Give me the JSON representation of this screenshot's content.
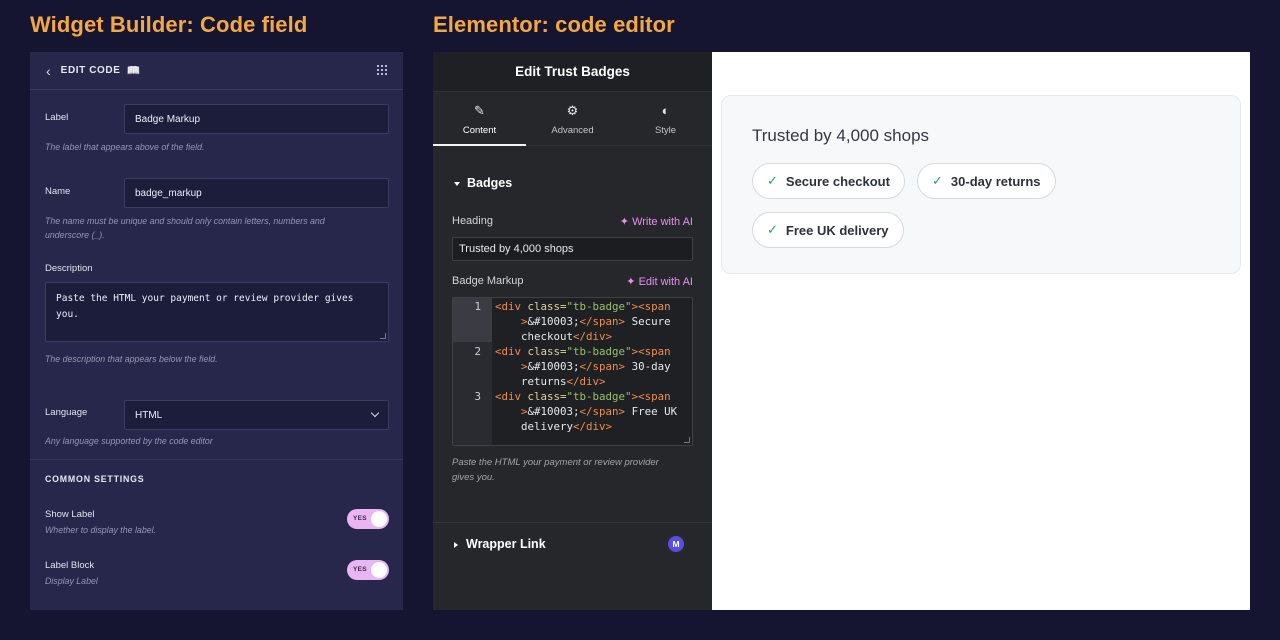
{
  "headings": {
    "left": "Widget Builder: Code field",
    "right": "Elementor: code editor"
  },
  "widget_builder": {
    "header": {
      "title": "EDIT CODE"
    },
    "label": {
      "label": "Label",
      "value": "Badge Markup",
      "help": "The label that appears above of the field."
    },
    "name": {
      "label": "Name",
      "value": "badge_markup",
      "help_line1": "The name must be unique and should only contain letters, numbers and",
      "help_line2": "underscore (_)."
    },
    "description": {
      "label": "Description",
      "value_line1": "Paste the HTML your payment or review provider gives",
      "value_line2": "you.",
      "help": "The description that appears below the field."
    },
    "language": {
      "label": "Language",
      "value": "HTML",
      "help": "Any language supported by the code editor"
    },
    "common_settings": "COMMON SETTINGS",
    "show_label": {
      "label": "Show Label",
      "help": "Whether to display the label.",
      "toggle": "YES"
    },
    "label_block": {
      "label": "Label Block",
      "help": "Display Label",
      "toggle": "YES"
    }
  },
  "elementor": {
    "title": "Edit Trust Badges",
    "tabs": [
      {
        "label": "Content",
        "icon": "pencil-icon"
      },
      {
        "label": "Advanced",
        "icon": "gear-icon"
      },
      {
        "label": "Style",
        "icon": "contrast-icon"
      }
    ],
    "section": "Badges",
    "heading_label": "Heading",
    "write_ai": "Write with AI",
    "heading_value": "Trusted by 4,000 shops",
    "markup_label": "Badge Markup",
    "edit_ai": "Edit with AI",
    "code_lines": [
      {
        "num": "1",
        "text": "Secure",
        "text2": "checkout"
      },
      {
        "num": "2",
        "text": "30-day",
        "text2": "returns"
      },
      {
        "num": "3",
        "text": "Free UK",
        "text2": "delivery"
      }
    ],
    "code_tokens": {
      "open": "<div",
      "attr": " class=",
      "str": "\"tb-badge\"",
      "gt": ">",
      "span_open": "<span",
      "entity": "&#10003;",
      "span_close": "</span>",
      "div_close": "</div>"
    },
    "help_line1": "Paste the HTML your payment or review provider",
    "help_line2": "gives you.",
    "wrapper": "Wrapper Link",
    "wrapper_badge": "M"
  },
  "preview": {
    "title": "Trusted by 4,000 shops",
    "check": "✓",
    "badges": [
      "Secure checkout",
      "30-day returns",
      "Free UK delivery"
    ]
  }
}
